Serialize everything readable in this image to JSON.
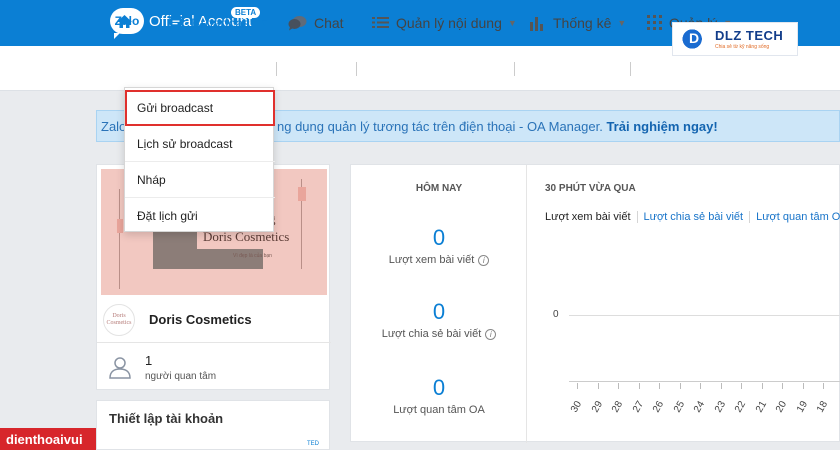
{
  "colors": {
    "brand_blue": "#0b7fd4",
    "highlight_red": "#e0302d",
    "watermark_red": "#d7262b"
  },
  "header": {
    "logo_mark": "Zalo",
    "logo_text": "Official Account",
    "beta_badge": "BETA"
  },
  "overlay_logo": {
    "name": "DLZ TECH",
    "tagline": "Chia sẻ từ kỹ năng sống"
  },
  "nav": {
    "home_icon": "home-icon",
    "items": [
      {
        "label": "Broadcast",
        "icon": "message-bubble-icon",
        "has_caret": true
      },
      {
        "label": "Chat",
        "icon": "chat-icon",
        "has_caret": false
      },
      {
        "label": "Quản lý nội dung",
        "icon": "list-icon",
        "has_caret": true
      },
      {
        "label": "Thống kê",
        "icon": "bar-chart-icon",
        "has_caret": true
      },
      {
        "label": "Quản lý",
        "icon": "grid-icon",
        "has_caret": true
      }
    ]
  },
  "broadcast_menu": {
    "items": [
      "Gửi broadcast",
      "Lịch sử broadcast",
      "Nháp",
      "Đặt lịch gửi"
    ],
    "highlighted_index": 0
  },
  "banner": {
    "lead": "Zalo",
    "text": "ng dụng quản lý tương tác trên điện thoại - OA Manager.",
    "link": "Trải nghiệm ngay!"
  },
  "profile": {
    "cover_title": "Doris Cosmetics",
    "cover_title_fragment": "g",
    "cover_subtitle": "Vì đẹp là của bạn",
    "avatar_text": "Doris Cosmetics",
    "name": "Doris Cosmetics",
    "followers_count": "1",
    "followers_label": "người quan tâm"
  },
  "account_setup": {
    "title": "Thiết lập tài khoản",
    "tiny_text": "TED"
  },
  "today": {
    "heading": "HÔM NAY",
    "stats": [
      {
        "value": "0",
        "label": "Lượt xem bài viết"
      },
      {
        "value": "0",
        "label": "Lượt chia sẻ bài viết"
      },
      {
        "value": "0",
        "label": "Lượt quan tâm OA"
      }
    ]
  },
  "recent": {
    "heading": "30 PHÚT VỪA QUA",
    "tabs": [
      "Lượt xem bài viết",
      "Lượt chia sẻ bài viết",
      "Lượt quan tâm OA"
    ]
  },
  "chart_data": {
    "type": "line",
    "y_ticks": [
      "0"
    ],
    "x": [
      "30",
      "29",
      "28",
      "27",
      "26",
      "25",
      "24",
      "23",
      "22",
      "21",
      "20",
      "19",
      "18"
    ],
    "values": [
      0,
      0,
      0,
      0,
      0,
      0,
      0,
      0,
      0,
      0,
      0,
      0,
      0
    ]
  },
  "watermark": {
    "text": "dienthoaivui"
  }
}
